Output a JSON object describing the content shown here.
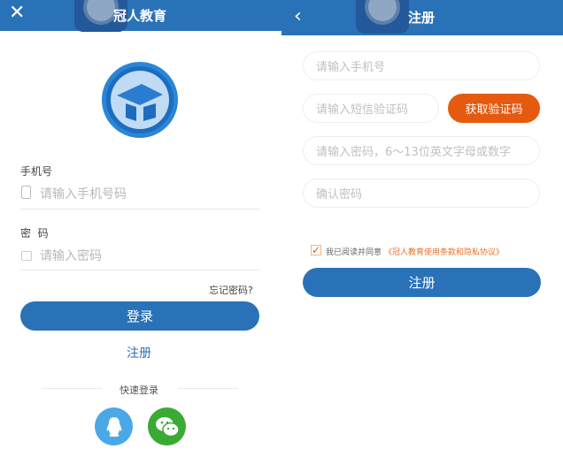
{
  "login": {
    "close_icon": "close-icon",
    "title": "冠人教育",
    "phone_label": "手机号",
    "phone_placeholder": "请输入手机号码",
    "password_label": "密  码",
    "password_placeholder": "请输入密码",
    "forgot": "忘记密码?",
    "login_button": "登录",
    "register_link": "注册",
    "quick_login": "快速登录"
  },
  "register": {
    "title": "注册",
    "phone_placeholder": "请输入手机号",
    "sms_placeholder": "请输入短信验证码",
    "get_code": "获取验证码",
    "password_placeholder": "请输入密码，6～13位英文字母或数字",
    "confirm_placeholder": "确认密码",
    "agree_text": "我已阅读并同意",
    "agree_link": "《冠人教育使用条款和隐私协议》",
    "register_button": "注册"
  },
  "colors": {
    "primary": "#2a72b8",
    "orange": "#e55a0e",
    "qq": "#4aa8e6",
    "wechat": "#3aaa35"
  }
}
